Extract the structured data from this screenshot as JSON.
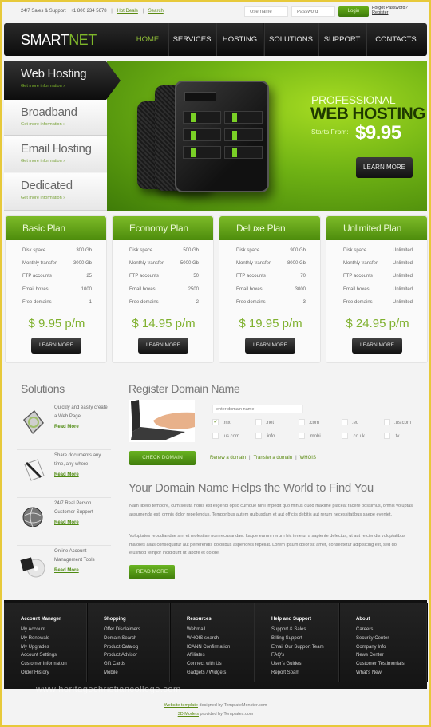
{
  "topbar": {
    "support_text": "24/7 Sales & Support",
    "phone": "+1 800 234 5678",
    "separator": "|",
    "links": [
      "Hot Deals",
      "Search"
    ],
    "username_placeholder": "Username",
    "password_placeholder": "Password",
    "login_label": "Login",
    "forgot_label": "Forgot Password?",
    "register_label": "Register"
  },
  "brand": {
    "part1": "SMART",
    "part2": "NET"
  },
  "nav": {
    "items": [
      {
        "label": "HOME",
        "active": true
      },
      {
        "label": "SERVICES"
      },
      {
        "label": "HOSTING"
      },
      {
        "label": "SOLUTIONS"
      },
      {
        "label": "SUPPORT"
      },
      {
        "label": "CONTACTS"
      }
    ]
  },
  "hero": {
    "tabs": [
      {
        "title": "Web Hosting",
        "sub": "Get more information  »",
        "active": true
      },
      {
        "title": "Broadband",
        "sub": "Get more information  »"
      },
      {
        "title": "Email Hosting",
        "sub": "Get more information  »"
      },
      {
        "title": "Dedicated",
        "sub": "Get more information  »"
      }
    ],
    "promo_line1": "PROFESSIONAL",
    "promo_line2": "WEB HOSTING",
    "starts_from": "Starts From:",
    "price": "$9.95",
    "cta": "LEARN MORE"
  },
  "plans": [
    {
      "name": "Basic Plan",
      "rows": [
        [
          "Disk space",
          "300 Gb"
        ],
        [
          "Monthly transfer",
          "3000 Gb"
        ],
        [
          "FTP accounts",
          "25"
        ],
        [
          "Email boxes",
          "1000"
        ],
        [
          "Free domains",
          "1"
        ]
      ],
      "price": "$ 9.95 p/m",
      "cta": "LEARN MORE"
    },
    {
      "name": "Economy Plan",
      "rows": [
        [
          "Disk space",
          "500 Gb"
        ],
        [
          "Monthly transfer",
          "5000 Gb"
        ],
        [
          "FTP accounts",
          "50"
        ],
        [
          "Email boxes",
          "2500"
        ],
        [
          "Free domains",
          "2"
        ]
      ],
      "price": "$ 14.95 p/m",
      "cta": "LEARN MORE"
    },
    {
      "name": "Deluxe Plan",
      "rows": [
        [
          "Disk space",
          "900 Gb"
        ],
        [
          "Monthly transfer",
          "8000 Gb"
        ],
        [
          "FTP accounts",
          "70"
        ],
        [
          "Email boxes",
          "3000"
        ],
        [
          "Free domains",
          "3"
        ]
      ],
      "price": "$ 19.95 p/m",
      "cta": "LEARN MORE"
    },
    {
      "name": "Unlimited Plan",
      "rows": [
        [
          "Disk space",
          "Unlimited"
        ],
        [
          "Monthly transfer",
          "Unlimited"
        ],
        [
          "FTP accounts",
          "Unlimited"
        ],
        [
          "Email boxes",
          "Unlimited"
        ],
        [
          "Free domains",
          "Unlimited"
        ]
      ],
      "price": "$ 24.95 p/m",
      "cta": "LEARN MORE"
    }
  ],
  "solutions": {
    "title": "Solutions",
    "items": [
      {
        "icon": "web-page-icon",
        "text": "Quickly and easily create a Web Page",
        "more": "Read More"
      },
      {
        "icon": "document-pen-icon",
        "text": "Share documents any time, any where",
        "more": "Read More"
      },
      {
        "icon": "globe-support-icon",
        "text": "24/7 Real Person Customer Support",
        "more": "Read More"
      },
      {
        "icon": "account-tools-icon",
        "text": "Online Account Management Tools",
        "more": "Read More"
      }
    ]
  },
  "domain": {
    "title": "Register Domain Name",
    "input_placeholder": "enter domain name",
    "tlds": [
      {
        "label": ".mx",
        "checked": true
      },
      {
        "label": ".net"
      },
      {
        "label": ".com"
      },
      {
        "label": ".eu"
      },
      {
        "label": ".us.com"
      },
      {
        "label": ".us.com"
      },
      {
        "label": ".info"
      },
      {
        "label": ".mobi"
      },
      {
        "label": ".co.uk"
      },
      {
        "label": ".tv"
      }
    ],
    "check_label": "CHECK DOMAIN",
    "links": [
      "Renew a domain",
      "Transfer a domain",
      "WHOIS"
    ]
  },
  "about": {
    "title": "Your Domain Name Helps the World  to Find You",
    "para1": "Nam libero tempore, cum soluta nobis est eligendi optio cumque nihil impedit quo minus quod maxime placeat facere possimus, omnis voluptas assumenda est, omnis dolor repellendus. Temporibus autem quibusdam et aut officiis debitis aut rerum necessitatibus saepe eveniet.",
    "para2": "Voluptates repudiandae sint et molestiae non recusandae. Itaque earum rerum hic tenetur a sapiente delectus, ut aut reiciendis voluptatibus maiores alias consequatur aut perferendis doloribus asperiores repellat. Lorem ipsum dolor sit amet, consectetur adipisicing elit, sed do eiusmod tempor incididunt ut labore et dolore.",
    "cta": "READ MORE"
  },
  "footer": {
    "columns": [
      {
        "title": "Account Manager",
        "links": [
          "My Account",
          "My Renewals",
          "My Upgrades",
          "Account Settings",
          "Customer Information",
          "Order History"
        ]
      },
      {
        "title": "Shopping",
        "links": [
          "Offer Disclaimers",
          "Domain Search",
          "Product Catalog",
          "Product Advisor",
          "Gift Cards",
          "Mobile"
        ]
      },
      {
        "title": "Resources",
        "links": [
          "Webmail",
          "WHOIS search",
          "ICANN Confirmation",
          "Affiliates",
          "Connect with Us",
          "Gadgets / Widgets"
        ]
      },
      {
        "title": "Help and Support",
        "links": [
          "Support & Sales",
          "Billing Support",
          "Email Our Support Team",
          "FAQ's",
          "User's Guides",
          "Report Spam"
        ]
      },
      {
        "title": "About",
        "links": [
          "Careers",
          "Security Center",
          "Company Info",
          "News Center",
          "Customer Testimonials",
          "What's New"
        ]
      }
    ],
    "watermark": "www.heritagechristiancollege.com"
  },
  "credits": {
    "line1_link": "Website template",
    "line1_text": " designed by TemplateMonster.com",
    "line2_link": "3D Models",
    "line2_text": " provided by Templates.com"
  }
}
